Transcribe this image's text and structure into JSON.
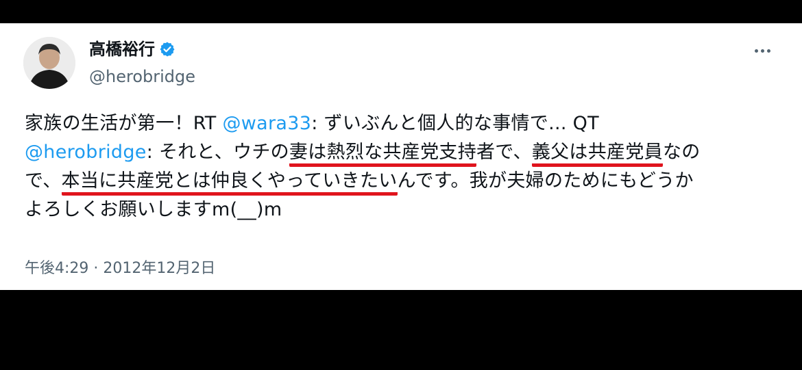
{
  "author": {
    "display_name": "高橋裕行",
    "handle": "@herobridge",
    "verified": true
  },
  "more_button": {
    "icon": "more-icon"
  },
  "tweet": {
    "line1_a": "家族の生活が第一！RT ",
    "line1_mention": "@wara33",
    "line1_b": ": ずいぶんと個人的な事情で... QT",
    "line2_mention": "@herobridge",
    "line2_a": ": それと、ウチの",
    "line2_ul1": "妻は熱烈な共産党支持",
    "line2_b": "者で、",
    "line2_ul2": "義父は共産党員",
    "line2_c": "なの",
    "line3_a": "で、",
    "line3_ul": "本当に共産党とは仲良くやっていきたい",
    "line3_b": "んです。我が夫婦のためにもどうか",
    "line4": "よろしくお願いしますm(__)m"
  },
  "timestamp": "午後4:29 · 2012年12月2日",
  "colors": {
    "mention": "#1d9bf0",
    "underline": "#e0141d",
    "verified": "#1d9bf0",
    "secondary_text": "#536471"
  }
}
